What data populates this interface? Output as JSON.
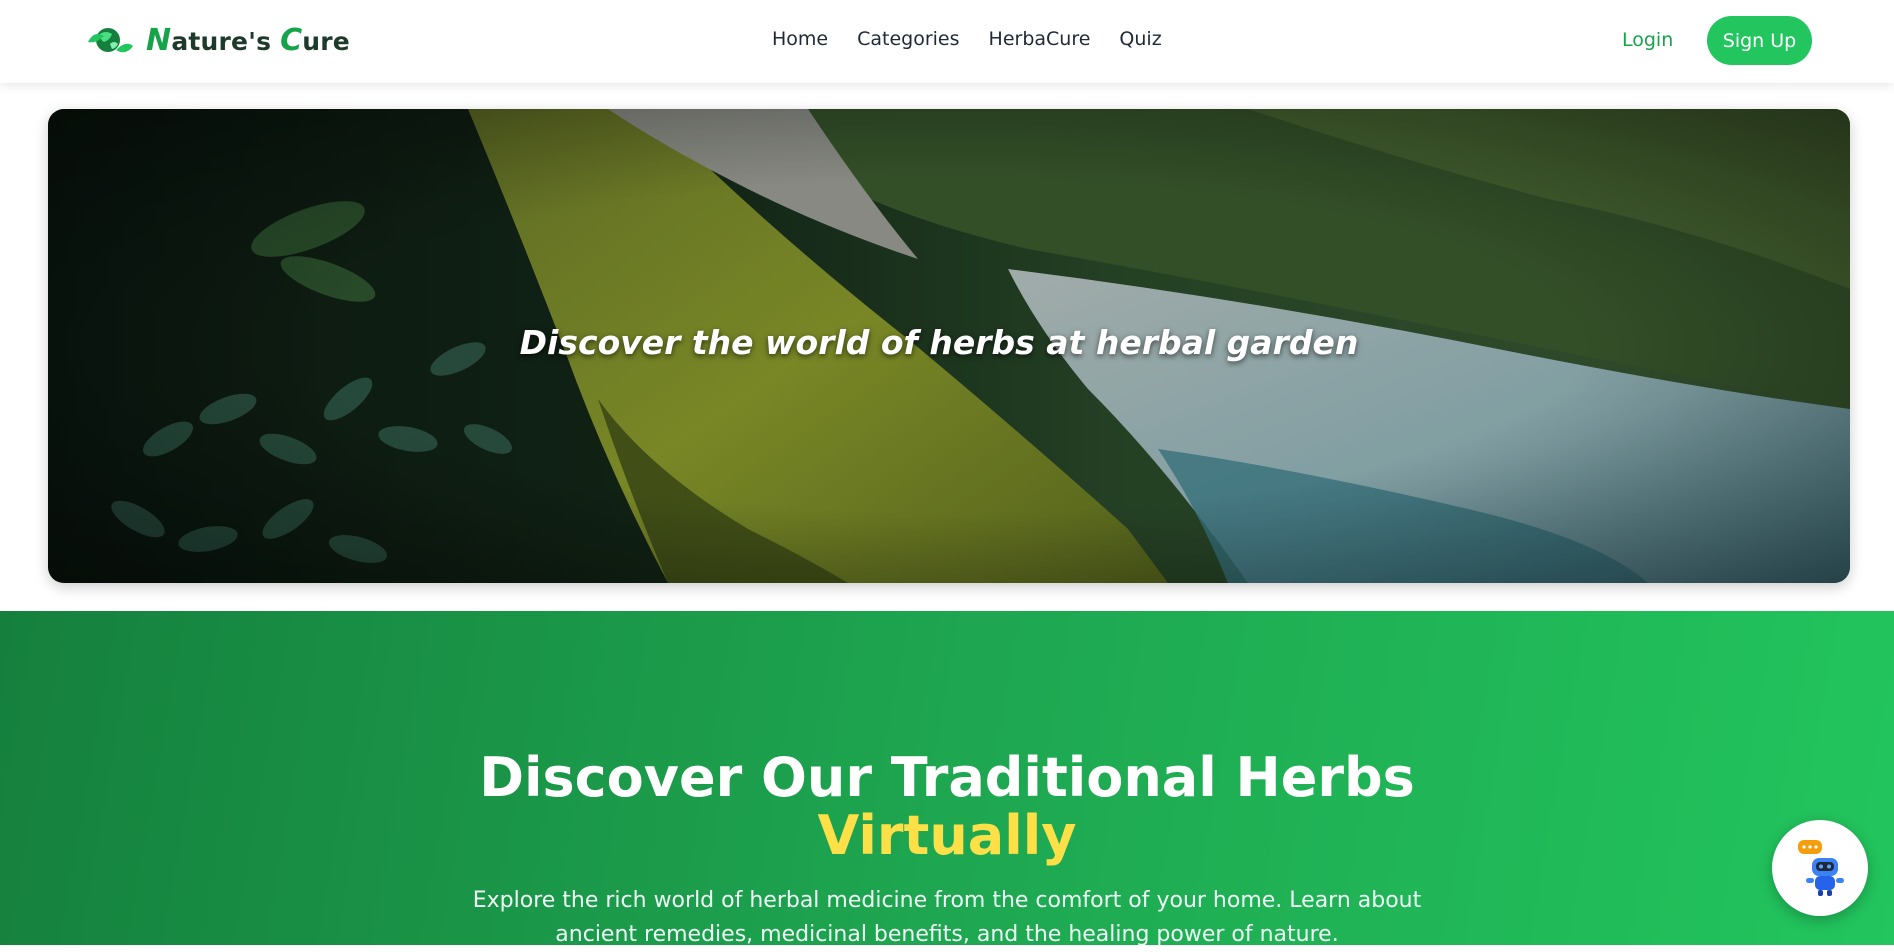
{
  "brand": {
    "name_initial_1": "N",
    "name_rest_1": "ature's ",
    "name_initial_2": "C",
    "name_rest_2": "ure",
    "icon": "leaf-globe-icon"
  },
  "nav": {
    "items": [
      {
        "label": "Home"
      },
      {
        "label": "Categories"
      },
      {
        "label": "HerbaCure"
      },
      {
        "label": "Quiz"
      }
    ]
  },
  "auth": {
    "login_label": "Login",
    "signup_label": "Sign Up"
  },
  "hero": {
    "caption": "Discover the world of herbs at herbal garden"
  },
  "section": {
    "title": "Discover Our Traditional Herbs",
    "title_accent": "Virtually",
    "description": "Explore the rich world of herbal medicine from the comfort of your home. Learn about ancient remedies, medicinal benefits, and the healing power of nature."
  },
  "chatbot": {
    "icon": "robot-chat-icon"
  },
  "colors": {
    "brand_green": "#16a34a",
    "signup_bg": "#22c55e",
    "accent_yellow": "#fde047"
  }
}
